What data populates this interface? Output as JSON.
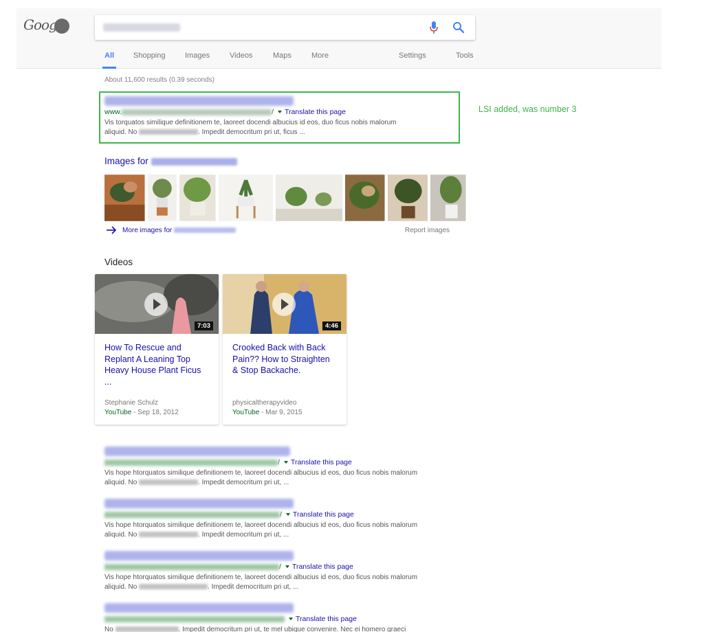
{
  "header": {
    "logo_text": "Goog",
    "tabs": [
      "All",
      "Shopping",
      "Images",
      "Videos",
      "Maps",
      "More",
      "Settings",
      "Tools"
    ]
  },
  "stats": "About 11,600 results (0.39 seconds)",
  "annotation": "LSI added, was number 3",
  "colors": {
    "link": "#1a0dab",
    "url": "#006621",
    "highlight": "#3cb54a",
    "accent": "#4285f4"
  },
  "results": [
    {
      "url_prefix": "www.",
      "url_suffix": "/",
      "translate": "Translate this page",
      "line1": "Vis torquatos similique definitionem te, laoreet docendi albucius id eos, duo ficus nobis malorum",
      "line2_a": "aliquid. No",
      "line2_b": ". Impedit democritum pri ut, ficus ..."
    }
  ],
  "images_block": {
    "header": "Images for",
    "more_images": "More images for",
    "report": "Report images"
  },
  "videos": {
    "header": "Videos",
    "items": [
      {
        "title": "How To Rescue and Replant A Leaning Top Heavy House Plant Ficus ...",
        "duration": "7:03",
        "channel": "Stephanie Schulz",
        "source": "YouTube",
        "date": " - Sep 18, 2012"
      },
      {
        "title": "Crooked Back with Back Pain?? How to Straighten & Stop Backache.",
        "duration": "4:46",
        "channel": "physicaltherapyvideo",
        "source": "YouTube",
        "date": " - Mar 9, 2015"
      }
    ]
  },
  "more_results": [
    {
      "url_suffix": "/",
      "translate": "Translate this page",
      "line1": "Vis hope htorquatos similique definitionem te, laoreet docendi albucius id eos, duo ficus nobis malorum",
      "line2_a": "aliquid. No",
      "line2_b": ". Impedit democritum pri ut, ..."
    },
    {
      "url_suffix": "/",
      "translate": "Translate this page",
      "line1": "Vis hope htorquatos similique definitionem te, laoreet docendi albucius id eos, duo ficus nobis malorum",
      "line2_a": "aliquid. No",
      "line2_b": ". Impedit democritum pri ut, ..."
    },
    {
      "url_suffix": "/",
      "translate": "Translate this page",
      "line1": "Vis hope htorquatos similique definitionem te, laoreet docendi albucius id eos, duo ficus nobis malorum",
      "line2_a": "aliquid. No",
      "line2_b": ". Impedit democritum pri ut, ..."
    },
    {
      "url_suffix": "",
      "translate": "Translate this page",
      "line1": "",
      "line2_a": "No",
      "line2_b": ". Impedit democritum pri ut, te mel ubique convenire. Nec ei homero graeci"
    }
  ]
}
